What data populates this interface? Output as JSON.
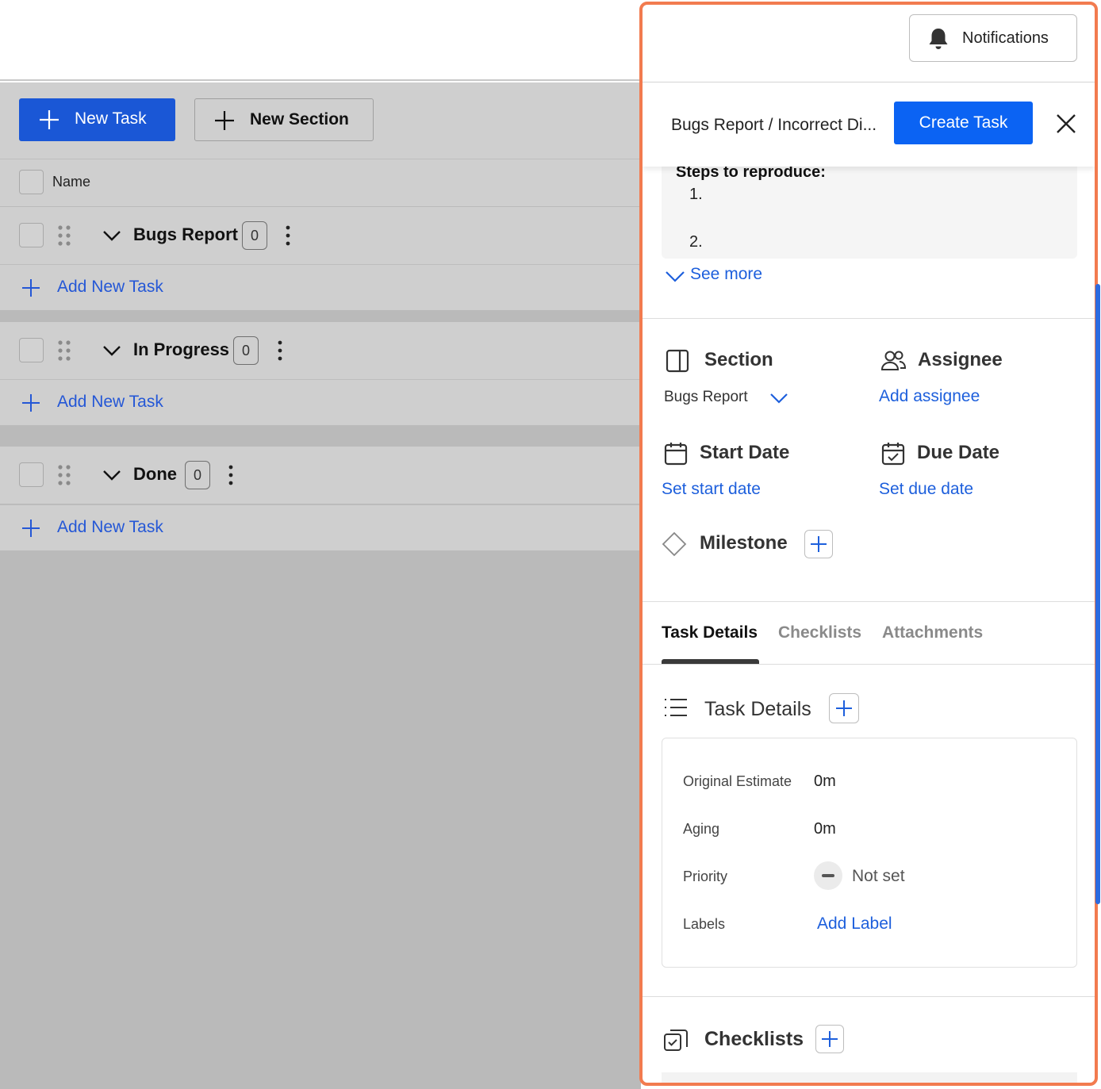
{
  "toolbar": {
    "new_task_label": "New Task",
    "new_section_label": "New Section"
  },
  "table": {
    "name_header": "Name"
  },
  "sections": [
    {
      "title": "Bugs Report",
      "count": "0",
      "add_label": "Add New Task"
    },
    {
      "title": "In Progress",
      "count": "0",
      "add_label": "Add New Task"
    },
    {
      "title": "Done",
      "count": "0",
      "add_label": "Add New Task"
    }
  ],
  "panel": {
    "notifications_label": "Notifications",
    "breadcrumb": "Bugs Report  / Incorrect Di...",
    "create_task_label": "Create Task",
    "description": {
      "heading": "Steps to reproduce:",
      "item_1": "1.",
      "item_2": "2.",
      "see_more": "See more"
    },
    "fields": {
      "section_title": "Section",
      "section_value": "Bugs Report",
      "assignee_title": "Assignee",
      "assignee_action": "Add assignee",
      "start_date_title": "Start Date",
      "start_date_action": "Set start date",
      "due_date_title": "Due Date",
      "due_date_action": "Set due date",
      "milestone_title": "Milestone"
    },
    "tabs": [
      "Task Details",
      "Checklists",
      "Attachments"
    ],
    "task_details": {
      "title": "Task Details",
      "original_estimate_label": "Original Estimate",
      "original_estimate_value": "0m",
      "aging_label": "Aging",
      "aging_value": "0m",
      "priority_label": "Priority",
      "priority_value": "Not set",
      "labels_label": "Labels",
      "labels_action": "Add Label"
    },
    "checklists_title": "Checklists"
  },
  "colors": {
    "primary": "#1a57d6",
    "create_button": "#0b63f3",
    "link": "#1d5fdc",
    "panel_border": "#f27b4f",
    "overlay_gray": "#cfcfcf"
  },
  "icons": {
    "new_task": "plus-icon",
    "new_section": "plus-icon",
    "drag": "drag-handle-icon",
    "collapse": "chevron-down-icon",
    "more": "kebab-icon",
    "notifications": "bell-icon",
    "close": "close-icon",
    "section": "sidebar-layout-icon",
    "assignee": "users-icon",
    "start_date": "calendar-icon",
    "due_date": "calendar-check-icon",
    "milestone": "diamond-icon",
    "task_details": "list-icon",
    "checklists": "checklist-copy-icon"
  }
}
